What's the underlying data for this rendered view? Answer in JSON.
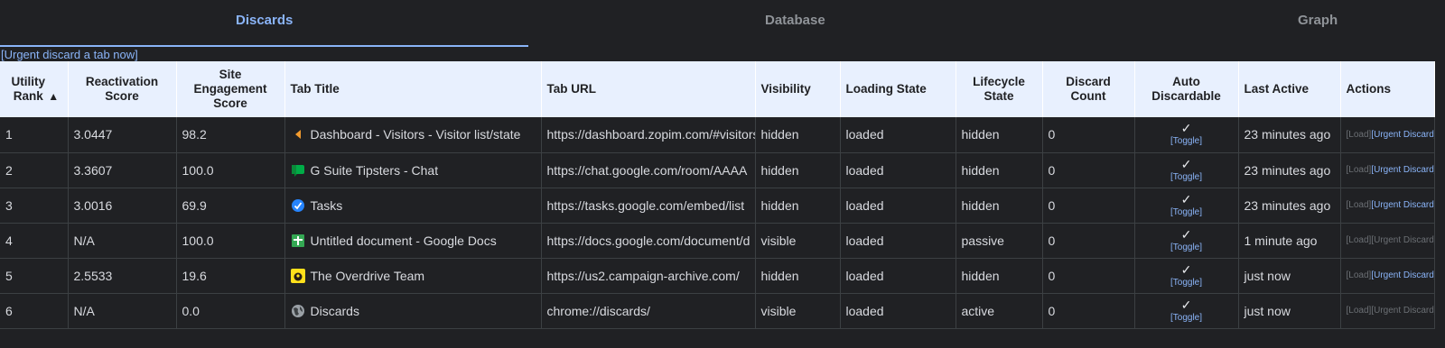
{
  "tabs": [
    "Discards",
    "Database",
    "Graph"
  ],
  "urgent_link": "[Urgent discard a tab now]",
  "headers": {
    "rank": "Utility Rank",
    "sort_arrow": "▲",
    "reactivation": "Reactivation Score",
    "engagement": "Site Engagement Score",
    "title": "Tab Title",
    "url": "Tab URL",
    "visibility": "Visibility",
    "loading": "Loading State",
    "lifecycle": "Lifecycle State",
    "discard_count": "Discard Count",
    "auto": "Auto Discardable",
    "last_active": "Last Active",
    "actions": "Actions"
  },
  "check_glyph": "✓",
  "toggle_label": "[Toggle]",
  "load_label": "[Load]",
  "urgent_label": "[Urgent Discard]",
  "rows": [
    {
      "rank": "1",
      "reactivation": "3.0447",
      "engagement": "98.2",
      "icon": "zopim-icon",
      "title": "Dashboard - Visitors - Visitor list/state",
      "url": "https://dashboard.zopim.com/#visitors",
      "visibility": "hidden",
      "loading": "loaded",
      "lifecycle": "hidden",
      "discard_count": "0",
      "last_active": "23 minutes ago",
      "urgent_enabled": true
    },
    {
      "rank": "2",
      "reactivation": "3.3607",
      "engagement": "100.0",
      "icon": "google-chat-icon",
      "title": "G Suite Tipsters - Chat",
      "url": "https://chat.google.com/room/AAAA",
      "visibility": "hidden",
      "loading": "loaded",
      "lifecycle": "hidden",
      "discard_count": "0",
      "last_active": "23 minutes ago",
      "urgent_enabled": true
    },
    {
      "rank": "3",
      "reactivation": "3.0016",
      "engagement": "69.9",
      "icon": "google-tasks-icon",
      "title": "Tasks",
      "url": "https://tasks.google.com/embed/list",
      "visibility": "hidden",
      "loading": "loaded",
      "lifecycle": "hidden",
      "discard_count": "0",
      "last_active": "23 minutes ago",
      "urgent_enabled": true
    },
    {
      "rank": "4",
      "reactivation": "N/A",
      "engagement": "100.0",
      "icon": "google-docs-icon",
      "title": "Untitled document - Google Docs",
      "url": "https://docs.google.com/document/d",
      "visibility": "visible",
      "loading": "loaded",
      "lifecycle": "passive",
      "discard_count": "0",
      "last_active": "1 minute ago",
      "urgent_enabled": false
    },
    {
      "rank": "5",
      "reactivation": "2.5533",
      "engagement": "19.6",
      "icon": "mailchimp-icon",
      "title": "The Overdrive Team",
      "url": "https://us2.campaign-archive.com/",
      "visibility": "hidden",
      "loading": "loaded",
      "lifecycle": "hidden",
      "discard_count": "0",
      "last_active": "just now",
      "urgent_enabled": true
    },
    {
      "rank": "6",
      "reactivation": "N/A",
      "engagement": "0.0",
      "icon": "globe-icon",
      "title": "Discards",
      "url": "chrome://discards/",
      "visibility": "visible",
      "loading": "loaded",
      "lifecycle": "active",
      "discard_count": "0",
      "last_active": "just now",
      "urgent_enabled": false
    }
  ],
  "colors": {
    "accent": "#8ab4f8",
    "background": "#202124",
    "header_bg": "#e8f0fe"
  }
}
